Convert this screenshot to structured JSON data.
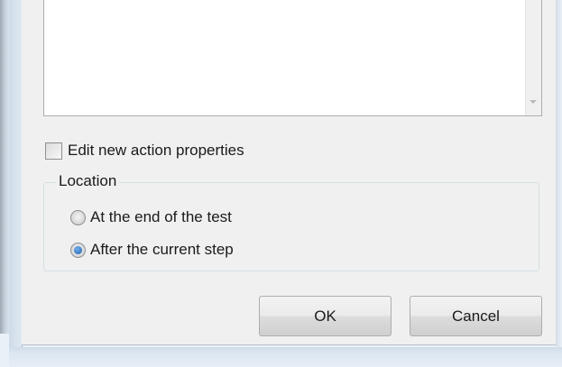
{
  "options": {
    "edit_new_action_properties": {
      "label": "Edit new action properties",
      "checked": false
    }
  },
  "location": {
    "title": "Location",
    "options": [
      {
        "label": "At the end of the test",
        "selected": false
      },
      {
        "label": "After the current step",
        "selected": true
      }
    ]
  },
  "buttons": {
    "ok_label": "OK",
    "cancel_label": "Cancel"
  },
  "colors": {
    "dialog_background": "#f0f0f0",
    "radio_selected": "#1e5ea8",
    "window_frame": "#dce6f1"
  }
}
